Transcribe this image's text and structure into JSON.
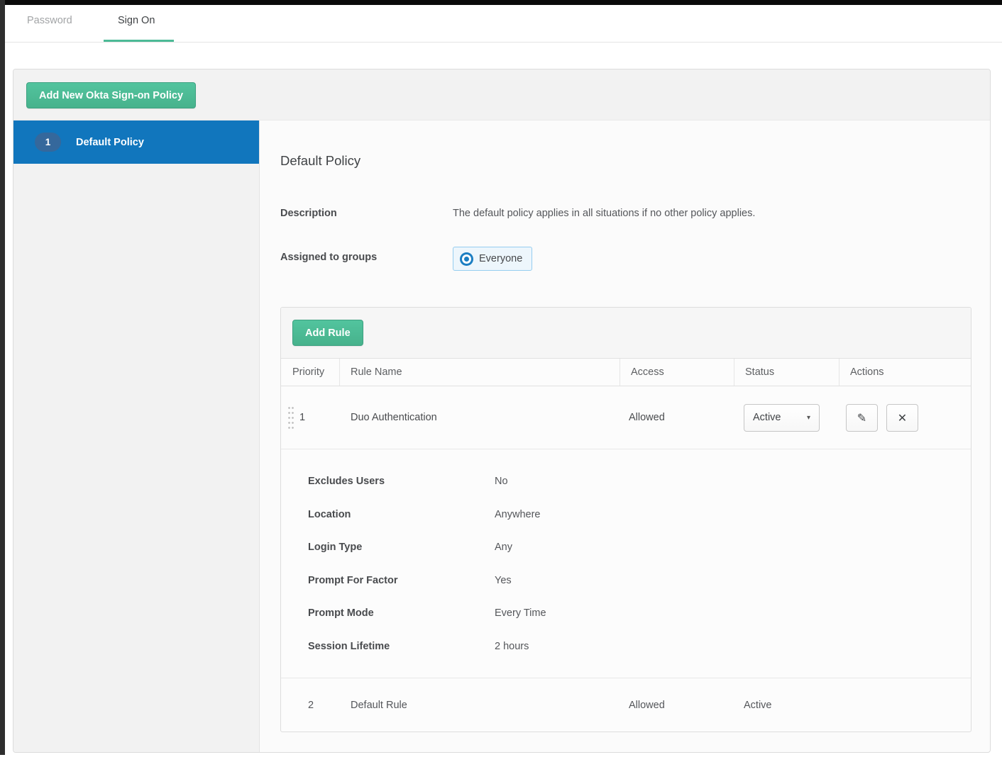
{
  "tabs": [
    {
      "label": "Password",
      "active": false
    },
    {
      "label": "Sign On",
      "active": true
    }
  ],
  "buttons": {
    "add_policy": "Add New Okta Sign-on Policy",
    "add_rule": "Add Rule"
  },
  "policies": [
    {
      "priority": "1",
      "name": "Default Policy",
      "selected": true
    }
  ],
  "policy": {
    "title": "Default Policy",
    "description_label": "Description",
    "description": "The default policy applies in all situations if no other policy applies.",
    "assigned_label": "Assigned to groups",
    "assigned_group": "Everyone"
  },
  "rules_table": {
    "columns": [
      "Priority",
      "Rule Name",
      "Access",
      "Status",
      "Actions"
    ],
    "rows": [
      {
        "priority": "1",
        "name": "Duo Authentication",
        "access": "Allowed",
        "status": "Active",
        "status_editable": true,
        "details": [
          {
            "label": "Excludes Users",
            "value": "No"
          },
          {
            "label": "Location",
            "value": "Anywhere"
          },
          {
            "label": "Login Type",
            "value": "Any"
          },
          {
            "label": "Prompt For Factor",
            "value": "Yes"
          },
          {
            "label": "Prompt Mode",
            "value": "Every Time"
          },
          {
            "label": "Session Lifetime",
            "value": "2 hours"
          }
        ]
      },
      {
        "priority": "2",
        "name": "Default Rule",
        "access": "Allowed",
        "status": "Active",
        "status_editable": false
      }
    ]
  },
  "icon_glyphs": {
    "edit": "✎",
    "delete": "✕",
    "caret": "▾"
  },
  "colors": {
    "accent_green": "#4cba96",
    "selected_blue": "#1176bd",
    "badge_blue": "#35689c",
    "chip_bg": "#edf6fc",
    "chip_border": "#96cdf0",
    "okta_o_blue": "#1b7ec2"
  }
}
